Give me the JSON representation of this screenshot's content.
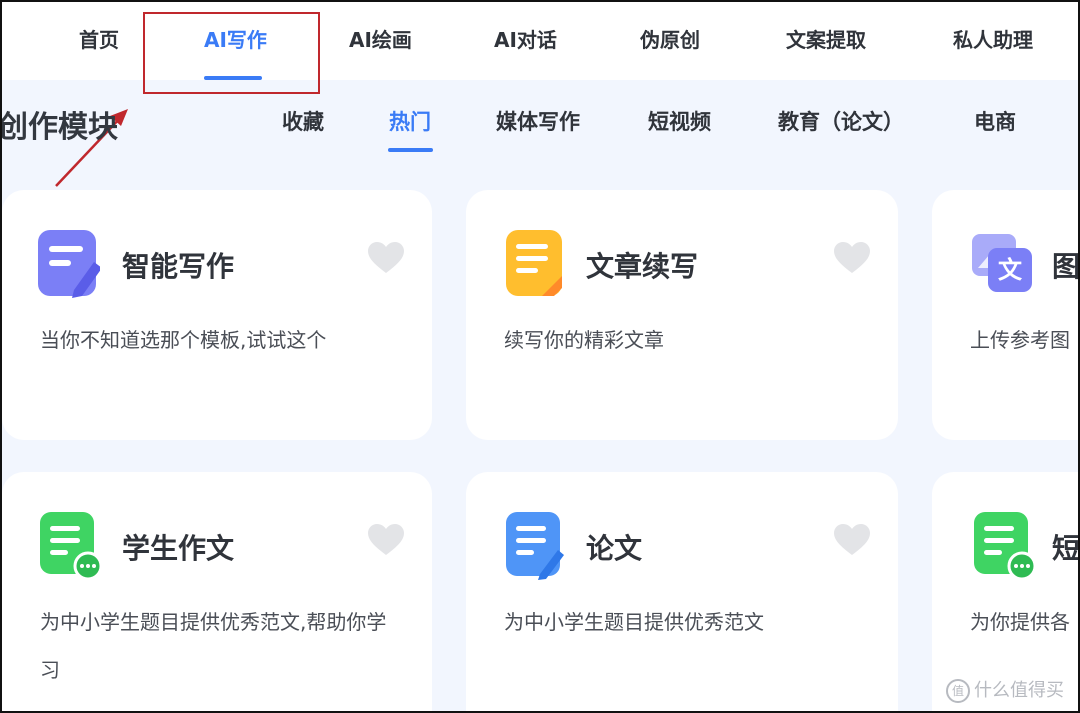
{
  "topnav": {
    "items": [
      "首页",
      "AI写作",
      "AI绘画",
      "AI对话",
      "伪原创",
      "文案提取",
      "私人助理"
    ],
    "active": "AI写作",
    "accent": "#3a7bf6"
  },
  "section": {
    "title": "创作模块",
    "categories": [
      "收藏",
      "热门",
      "媒体写作",
      "短视频",
      "教育（论文）",
      "电商"
    ],
    "active_category": "热门"
  },
  "cards": [
    {
      "name": "智能写作",
      "desc": "当你不知道选那个模板,试试这个",
      "icon": "edit-document-icon",
      "color": "#7b7ff6"
    },
    {
      "name": "文章续写",
      "desc": "续写你的精彩文章",
      "icon": "document-continue-icon",
      "color": "#ffbe2e"
    },
    {
      "name": "图",
      "desc": "上传参考图",
      "icon": "image-text-icon",
      "color": "#7b7ff6"
    },
    {
      "name": "学生作文",
      "desc": "为中小学生题目提供优秀范文,帮助你学习",
      "icon": "chat-document-icon",
      "color": "#3fd463"
    },
    {
      "name": "论文",
      "desc": "为中小学生题目提供优秀范文",
      "icon": "paper-edit-icon",
      "color": "#4f95f7"
    },
    {
      "name": "短",
      "desc": "为你提供各",
      "icon": "chat-document-icon",
      "color": "#3fd463"
    }
  ],
  "watermark": {
    "logo": "值",
    "text": "什么值得买"
  },
  "annotation_color": "#c0282d"
}
